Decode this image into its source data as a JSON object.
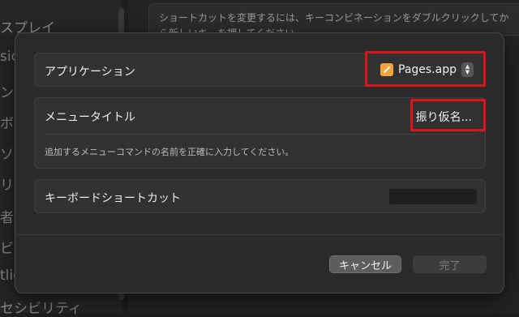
{
  "background": {
    "sidebar_fragments": [
      "スプレイ",
      "sic",
      "ン",
      "ボ",
      "ソ",
      "リ",
      "者",
      "ビ",
      "tlie",
      "セシビリティ"
    ],
    "banner_line1": "ショートカットを変更するには、キーコンビネーションをダブルクリックしてか",
    "banner_line2": "ら新しいキーを押してください。"
  },
  "dialog": {
    "app_row": {
      "label": "アプリケーション",
      "app_name": "Pages.app",
      "app_icon": "pages-icon"
    },
    "menu_row": {
      "label": "メニュータイトル",
      "value": "振り仮名...",
      "hint": "追加するメニューコマンドの名前を正確に入力してください。"
    },
    "shortcut_row": {
      "label": "キーボードショートカット",
      "value": ""
    },
    "buttons": {
      "cancel": "キャンセル",
      "done": "完了"
    }
  },
  "colors": {
    "highlight": "#e0121c",
    "dialog_bg": "#2a2a2a",
    "card_bg": "#313131"
  }
}
